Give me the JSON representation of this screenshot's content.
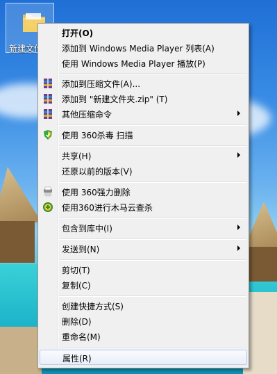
{
  "desktop": {
    "icon_label": "新建文件夹"
  },
  "menu": {
    "items": [
      {
        "label": "打开(O)",
        "bold": true,
        "icon": ""
      },
      {
        "label": "添加到 Windows Media Player 列表(A)",
        "icon": ""
      },
      {
        "label": "使用 Windows Media Player 播放(P)",
        "icon": ""
      },
      {
        "label": "添加到压缩文件(A)...",
        "icon": "winrar-icon"
      },
      {
        "label": "添加到 \"新建文件夹.zip\" (T)",
        "icon": "winrar-icon"
      },
      {
        "label": "其他压缩命令",
        "icon": "winrar-icon",
        "submenu": true
      },
      {
        "label": "使用 360杀毒 扫描",
        "icon": "360-shield-icon"
      },
      {
        "label": "共享(H)",
        "icon": "",
        "submenu": true
      },
      {
        "label": "还原以前的版本(V)",
        "icon": ""
      },
      {
        "label": "使用 360强力删除",
        "icon": "shredder-icon"
      },
      {
        "label": "使用360进行木马云查杀",
        "icon": "360-trojan-icon"
      },
      {
        "label": "包含到库中(I)",
        "icon": "",
        "submenu": true
      },
      {
        "label": "发送到(N)",
        "icon": "",
        "submenu": true
      },
      {
        "label": "剪切(T)",
        "icon": ""
      },
      {
        "label": "复制(C)",
        "icon": ""
      },
      {
        "label": "创建快捷方式(S)",
        "icon": ""
      },
      {
        "label": "删除(D)",
        "icon": ""
      },
      {
        "label": "重命名(M)",
        "icon": ""
      },
      {
        "label": "属性(R)",
        "icon": ""
      }
    ]
  }
}
